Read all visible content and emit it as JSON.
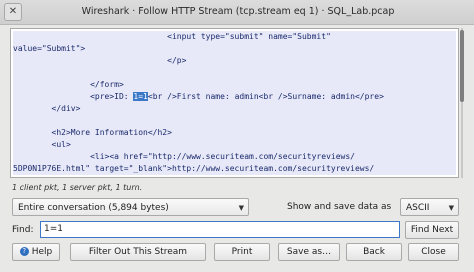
{
  "window": {
    "title": "Wireshark · Follow HTTP Stream (tcp.stream eq 1) · SQL_Lab.pcap",
    "close_glyph": "✕"
  },
  "stream": {
    "lines": [
      {
        "text": "                                <input type=\"submit\" name=\"Submit\"",
        "dir": "client"
      },
      {
        "text": "value=\"Submit\">",
        "dir": "client"
      },
      {
        "text": "                                </p>",
        "dir": "client"
      },
      {
        "text": "",
        "dir": "client"
      },
      {
        "text": "                </form>",
        "dir": "client"
      },
      {
        "text_pre": "                <pre>ID: ",
        "text_hl": "1=1",
        "text_post": "<br />First name: admin<br />Surname: admin</pre>",
        "dir": "client"
      },
      {
        "text": "        </div>",
        "dir": "client"
      },
      {
        "text": "",
        "dir": "client"
      },
      {
        "text": "        <h2>More Information</h2>",
        "dir": "client"
      },
      {
        "text": "        <ul>",
        "dir": "client"
      },
      {
        "text": "                <li><a href=\"http://www.securiteam.com/securityreviews/",
        "dir": "client"
      },
      {
        "text": "5DP0N1P76E.html\" target=\"_blank\">http://www.securiteam.com/securityreviews/",
        "dir": "client"
      }
    ]
  },
  "status": "1 client pkt, 1 server pkt, 1 turn.",
  "conversation_select": {
    "value": "Entire conversation (5,894 bytes)"
  },
  "show_save": {
    "label": "Show and save data as",
    "value": "ASCII"
  },
  "find": {
    "label": "Find:",
    "value": "1=1",
    "button": "Find Next"
  },
  "buttons": {
    "help": "Help",
    "filter_out": "Filter Out This Stream",
    "print": "Print",
    "save_as": "Save as…",
    "back": "Back",
    "close": "Close"
  },
  "colors": {
    "highlight": "#3b78c8",
    "client_bg": "#e7e9f8",
    "text": "#1a2a6b"
  }
}
